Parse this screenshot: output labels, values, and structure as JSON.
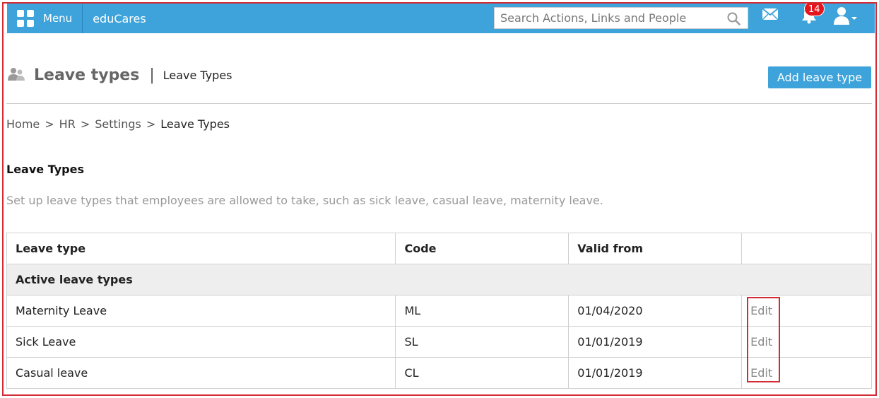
{
  "topbar": {
    "menu_label": "Menu",
    "brand": "eduCares",
    "search_placeholder": "Search Actions, Links and People",
    "notification_count": "14",
    "icons": [
      "apps-grid-icon",
      "search-icon",
      "mail-icon",
      "bell-icon",
      "user-icon"
    ]
  },
  "header": {
    "title": "Leave types",
    "separator": "|",
    "subtitle": "Leave Types",
    "add_button": "Add leave type"
  },
  "breadcrumb": {
    "items": [
      "Home",
      "HR",
      "Settings"
    ],
    "current": "Leave Types",
    "separator": ">"
  },
  "section": {
    "title": "Leave Types",
    "description": "Set up leave types that employees are allowed to take, such as sick leave, casual leave, maternity leave."
  },
  "table": {
    "columns": [
      "Leave type",
      "Code",
      "Valid from",
      ""
    ],
    "group_label": "Active leave types",
    "rows": [
      {
        "leave_type": "Maternity Leave",
        "code": "ML",
        "valid_from": "01/04/2020",
        "action": "Edit"
      },
      {
        "leave_type": "Sick Leave",
        "code": "SL",
        "valid_from": "01/01/2019",
        "action": "Edit"
      },
      {
        "leave_type": "Casual leave",
        "code": "CL",
        "valid_from": "01/01/2019",
        "action": "Edit"
      }
    ]
  },
  "colors": {
    "accent": "#3da3da",
    "badge": "#e3161e",
    "annotation_border": "#d42a33"
  }
}
